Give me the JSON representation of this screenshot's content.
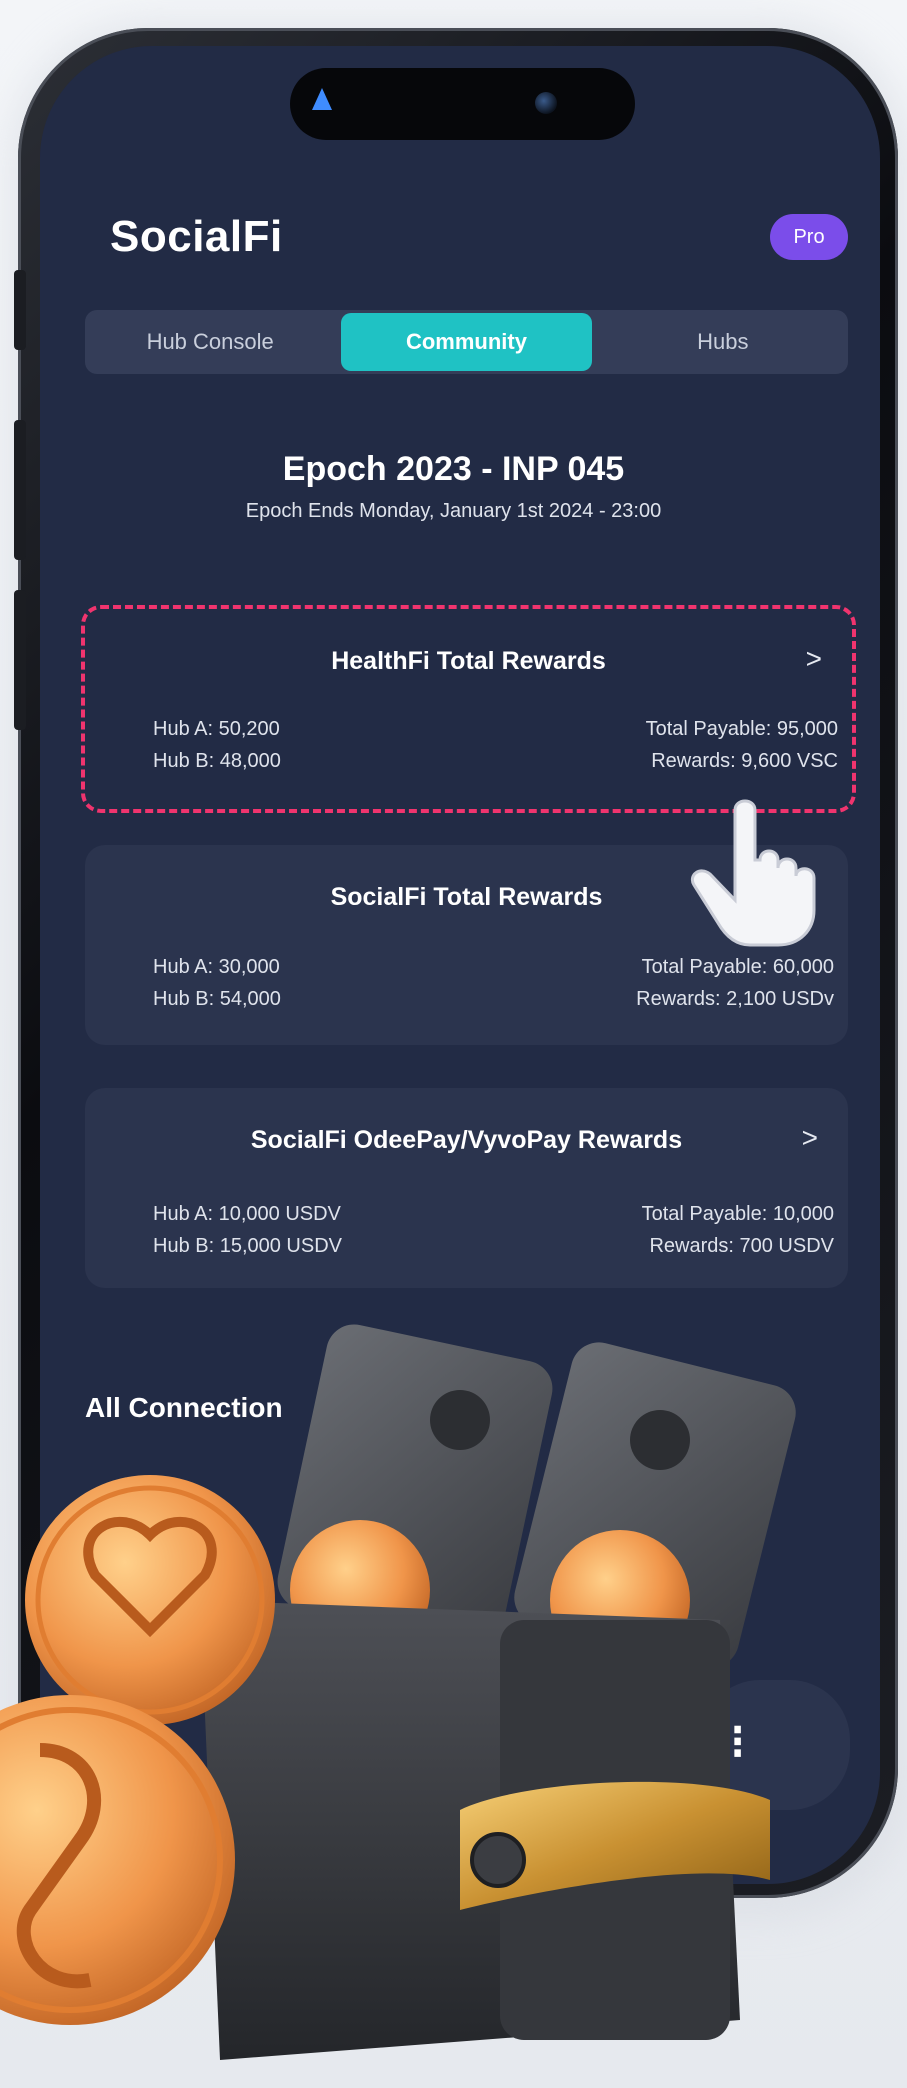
{
  "app": {
    "title": "SocialFi",
    "badge": "Pro"
  },
  "tabs": [
    {
      "label": "Hub Console",
      "active": false
    },
    {
      "label": "Community",
      "active": true
    },
    {
      "label": "Hubs",
      "active": false
    }
  ],
  "epoch": {
    "title": "Epoch 2023 - INP 045",
    "subtitle": "Epoch Ends Monday, January 1st 2024 - 23:00"
  },
  "cards": [
    {
      "title": "HealthFi Total Rewards",
      "hub_a": "Hub A: 50,200",
      "hub_b": "Hub B: 48,000",
      "total_payable": "Total Payable: 95,000",
      "rewards": "Rewards: 9,600 VSC",
      "chevron": ">"
    },
    {
      "title": "SocialFi Total Rewards",
      "hub_a": "Hub A: 30,000",
      "hub_b": "Hub B: 54,000",
      "total_payable": "Total Payable: 60,000",
      "rewards": "Rewards: 2,100 USDv",
      "chevron": ">"
    },
    {
      "title": "SocialFi OdeePay/VyvoPay Rewards",
      "hub_a": "Hub A: 10,000 USDV",
      "hub_b": "Hub B: 15,000 USDV",
      "total_payable": "Total Payable: 10,000",
      "rewards": "Rewards: 700 USDV",
      "chevron": ">"
    }
  ],
  "connections": {
    "title": "All Connection"
  },
  "colors": {
    "screen_bg": "#222b45",
    "card_bg": "#2b344e",
    "accent": "#1fc2c4",
    "badge": "#7b4dea",
    "highlight_border": "#f0346e"
  },
  "icons": [
    "navigation-arrow-icon",
    "camera-icon",
    "chevron-right-icon",
    "pointer-hand-icon",
    "wallet-illustration",
    "coin-icon"
  ]
}
